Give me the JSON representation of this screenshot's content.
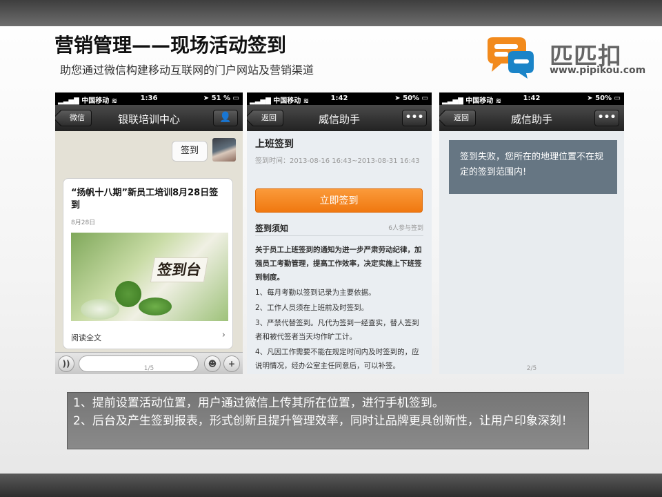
{
  "slide": {
    "title": "营销管理——现场活动签到",
    "subtitle": "助您通过微信构建移动互联网的门户网站及营销渠道",
    "logo": {
      "name": "匹匹扣",
      "url": "www.pipikou.com",
      "colors": {
        "orange": "#f28a1c",
        "blue": "#1a84c8"
      }
    }
  },
  "phone1": {
    "status": {
      "carrier": "中国移动",
      "time": "1:36",
      "battery": "51 %"
    },
    "nav": {
      "back": "微信",
      "title": "银联培训中心",
      "right_icon": "person-icon"
    },
    "chat_bubble": "签到",
    "article": {
      "title": "“扬帆十八期”新员工培训8月28日签到",
      "date": "8月28日",
      "image_sign": "签到台",
      "read_more": "阅读全文"
    },
    "input_bar": {
      "left_icon": "voice-icon",
      "emoji_icon": "emoji-icon",
      "plus_icon": "plus-icon"
    },
    "page": "1/5"
  },
  "phone2": {
    "status": {
      "carrier": "中国移动",
      "time": "1:42",
      "battery": "50%"
    },
    "nav": {
      "back": "返回",
      "title": "威信助手",
      "right": "•••"
    },
    "heading": "上班签到",
    "time_range": "签到时间：2013-08-16 16:43~2013-08-31 16:43",
    "checkin_button": "立即签到",
    "notice_heading": "签到须知",
    "participants": "6人参与签到",
    "intro": "关于员工上班签到的通知为进一步严肃劳动纪律，加强员工考勤管理，提高工作效率，决定实施上下班签到制度。",
    "rules": [
      "1、每月考勤以签到记录为主要依据。",
      "2、工作人员须在上班前及时签到。",
      "3、严禁代替签到。凡代为签到一经查实，替人签到者和被代签者当天均作旷工计。",
      "4、凡因工作需要不能在规定时间内及时签到的，应说明情况，经办公室主任同意后，可以补签。"
    ]
  },
  "phone3": {
    "status": {
      "carrier": "中国移动",
      "time": "1:42",
      "battery": "50%"
    },
    "nav": {
      "back": "返回",
      "title": "威信助手",
      "right": "•••"
    },
    "message": "签到失败，您所在的地理位置不在规定的签到范围内!",
    "page": "2/5"
  },
  "caption": {
    "line1": "1、提前设置活动位置，用户通过微信上传其所在位置，进行手机签到。",
    "line2": "2、后台及产生签到报表，形式创新且提升管理效率，同时让品牌更具创新性，让用户印象深刻！"
  }
}
